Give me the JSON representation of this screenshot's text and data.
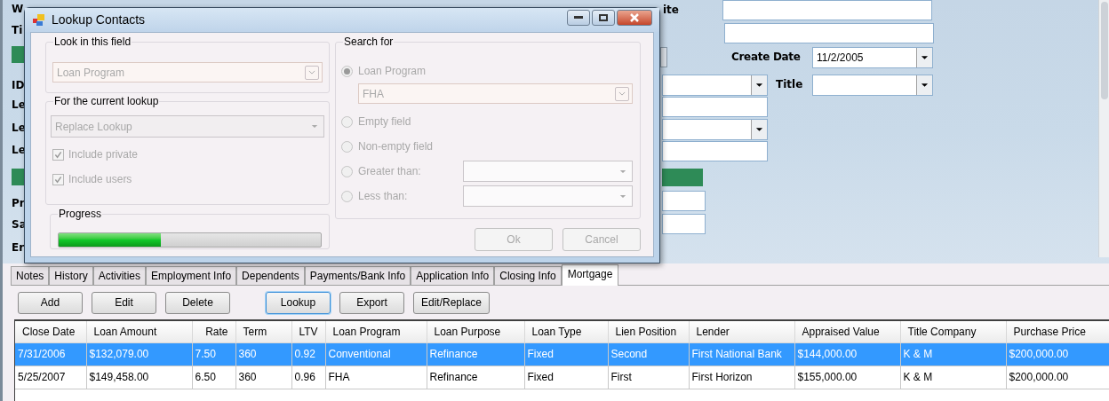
{
  "background_form": {
    "left_labels": [
      "W",
      "Ti",
      "ID",
      "Le",
      "Le",
      "Le",
      "Pr",
      "Sa",
      "Er"
    ],
    "website_label": "ite",
    "create_date": {
      "label": "Create Date",
      "value": "11/2/2005"
    },
    "title": {
      "label": "Title"
    }
  },
  "dialog": {
    "title": "Lookup Contacts",
    "controls_disabled": true,
    "look_in": {
      "legend": "Look in this field",
      "value": "Loan Program"
    },
    "current_lookup": {
      "legend": "For the current lookup",
      "value": "Replace Lookup",
      "checkboxes": [
        {
          "label": "Include private",
          "checked": true
        },
        {
          "label": "Include users",
          "checked": true
        }
      ]
    },
    "search_for": {
      "legend": "Search for",
      "options": [
        {
          "label": "Loan Program",
          "selected": true,
          "kind": "value",
          "value": "FHA"
        },
        {
          "label": "Empty field",
          "selected": false,
          "kind": "plain"
        },
        {
          "label": "Non-empty field",
          "selected": false,
          "kind": "plain"
        },
        {
          "label": "Greater than:",
          "selected": false,
          "kind": "compare"
        },
        {
          "label": "Less than:",
          "selected": false,
          "kind": "compare"
        }
      ]
    },
    "progress": {
      "legend": "Progress",
      "level": 0.39
    },
    "buttons": [
      "Ok",
      "Cancel"
    ]
  },
  "tabs": [
    {
      "label": "Notes",
      "selected": false
    },
    {
      "label": "History",
      "selected": false
    },
    {
      "label": "Activities",
      "selected": false
    },
    {
      "label": "Employment Info",
      "selected": false
    },
    {
      "label": "Dependents",
      "selected": false
    },
    {
      "label": "Payments/Bank Info",
      "selected": false
    },
    {
      "label": "Application Info",
      "selected": false
    },
    {
      "label": "Closing Info",
      "selected": false
    },
    {
      "label": "Mortgage",
      "selected": true
    }
  ],
  "toolbar": [
    {
      "label": "Add",
      "focused": false
    },
    {
      "label": "Edit",
      "focused": false
    },
    {
      "label": "Delete",
      "focused": false
    },
    {
      "label": "Lookup",
      "focused": true
    },
    {
      "label": "Export",
      "focused": false
    },
    {
      "label": "Edit/Replace",
      "focused": false
    }
  ],
  "table": {
    "columns": [
      "Close Date",
      "Loan Amount",
      "Rate",
      "Term",
      "LTV",
      "Loan Program",
      "Loan Purpose",
      "Loan Type",
      "Lien Position",
      "Lender",
      "Appraised Value",
      "Title Company",
      "Purchase Price"
    ],
    "rows": [
      {
        "selected": true,
        "cells": [
          "7/31/2006",
          "$132,079.00",
          "7.50",
          "360",
          "0.92",
          "Conventional",
          "Refinance",
          "Fixed",
          "Second",
          "First National Bank",
          "$144,000.00",
          "K & M",
          "$200,000.00"
        ]
      },
      {
        "selected": false,
        "cells": [
          "5/25/2007",
          "$149,458.00",
          "6.50",
          "360",
          "0.96",
          "FHA",
          "Refinance",
          "Fixed",
          "First",
          "First Horizon",
          "$155,000.00",
          "K & M",
          "$200,000.00"
        ]
      }
    ]
  }
}
